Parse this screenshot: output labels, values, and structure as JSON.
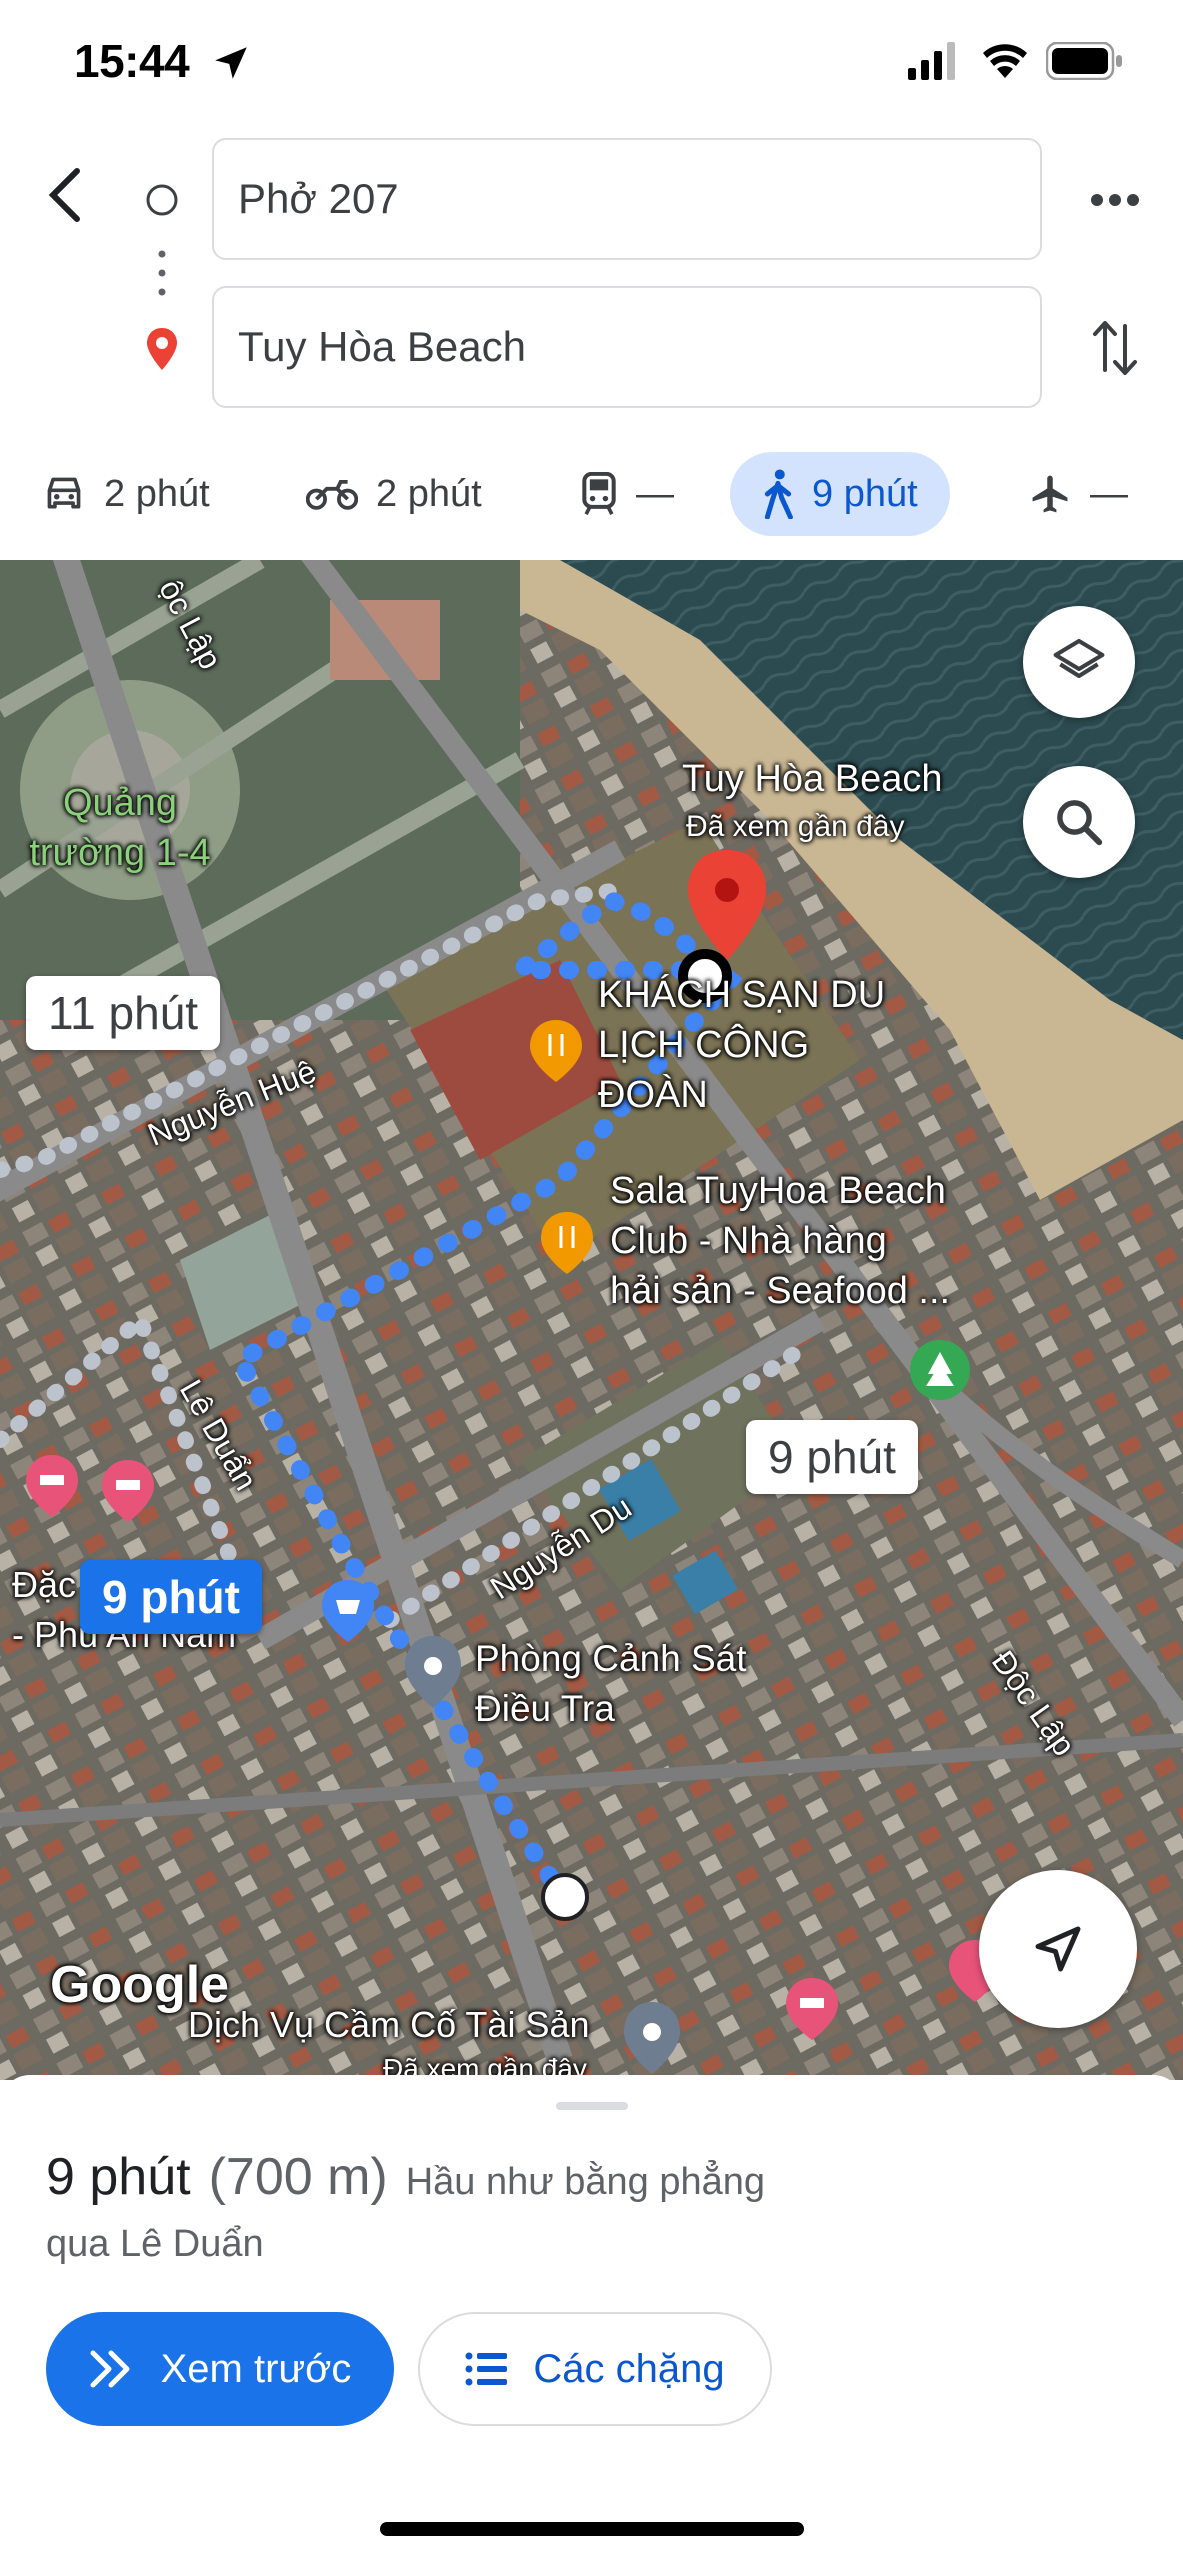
{
  "status": {
    "time": "15:44"
  },
  "route": {
    "origin": "Phở 207",
    "destination": "Tuy Hòa Beach"
  },
  "modes": [
    {
      "icon": "car-icon",
      "label": "2 phút"
    },
    {
      "icon": "motorbike-icon",
      "label": "2 phút"
    },
    {
      "icon": "transit-icon",
      "label": "—"
    },
    {
      "icon": "walk-icon",
      "label": "9 phút",
      "active": true
    },
    {
      "icon": "flight-icon",
      "label": "—"
    }
  ],
  "map": {
    "labels": {
      "doc_lap_top": "ộc Lập",
      "quang_truong": "Quảng\ntrường 1-4",
      "dest_name": "Tuy Hòa Beach",
      "dest_sub": "Đã xem gần đây",
      "hotel": "KHÁCH SẠN DU\nLỊCH CÔNG\nĐOÀN",
      "sala": "Sala TuyHoa Beach\nClub - Nhà hàng\nhải sản - Seafood ...",
      "nguyen_hue": "Nguyễn Huệ",
      "le_duan": "Lê Duẩn",
      "nguyen_du": "Nguyễn Du",
      "doc_lap_right": "Độc Lập",
      "dac_phu_an_nam": "Đặc Sản\n- Phú An Nam",
      "phong_canh_sat": "Phòng Cảnh Sát\nĐiều Tra",
      "dich_vu": "Dịch Vụ Cầm Cố Tài Sản",
      "dich_vu_sub": "Đã xem gần đây",
      "google": "Google"
    },
    "bubbles": {
      "alt1": "11 phút",
      "main": "9 phút",
      "alt2": "9 phút"
    }
  },
  "sheet": {
    "duration": "9 phút",
    "distance": "(700 m)",
    "terrain": "Hầu như bằng phẳng",
    "via": "qua Lê Duẩn",
    "preview_button": "Xem trước",
    "steps_button": "Các chặng"
  },
  "colors": {
    "accent": "#1a73e8",
    "route": "#4285f4",
    "marker": "#ea4335"
  }
}
